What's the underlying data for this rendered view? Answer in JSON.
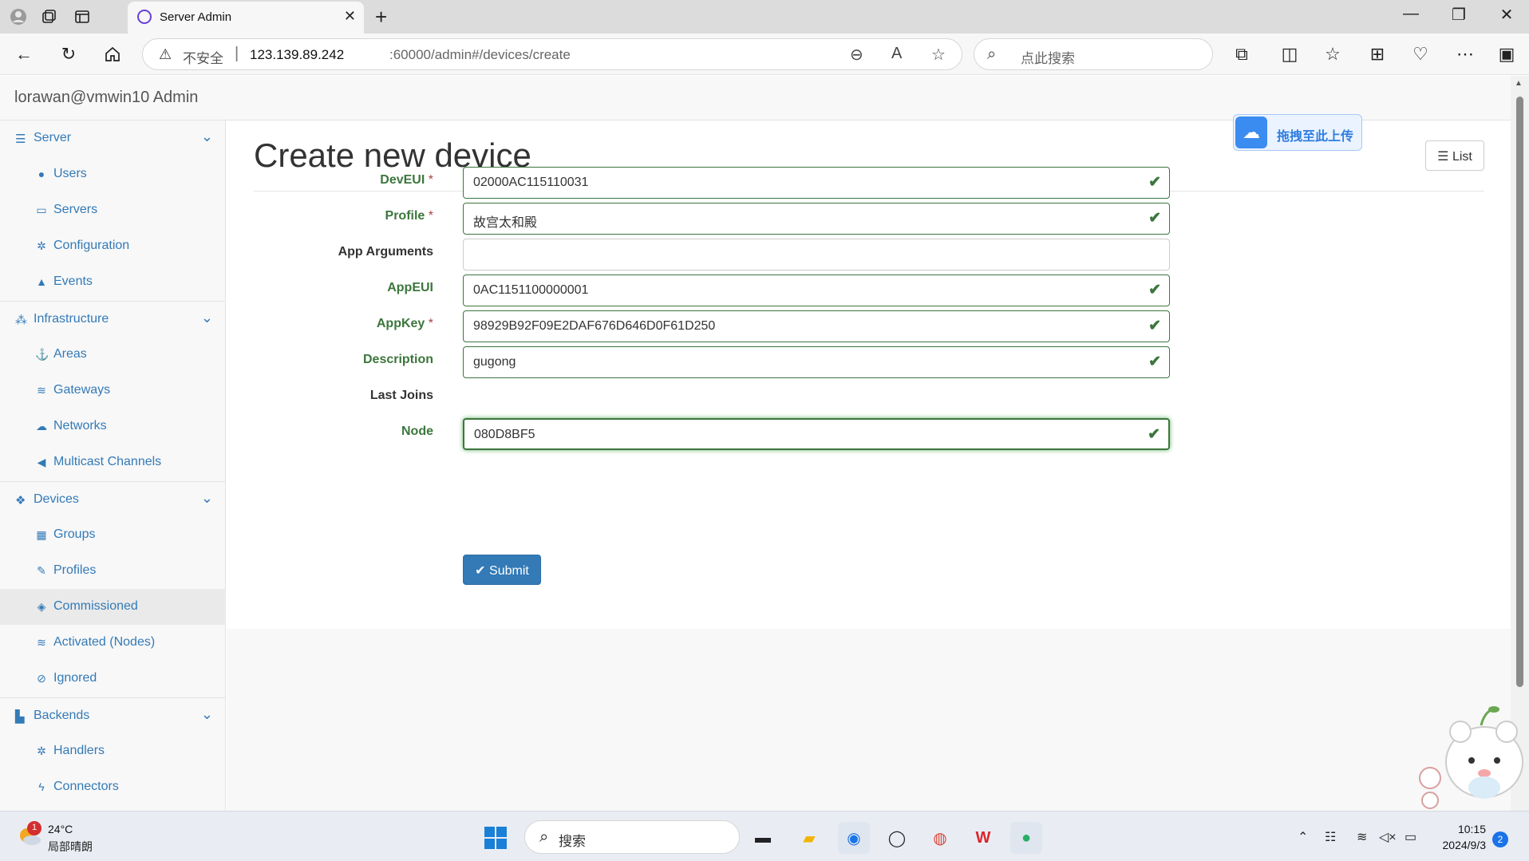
{
  "browser": {
    "tab_title": "Server Admin",
    "url_warning": "不安全",
    "url_host": "123.139.89.242",
    "url_path": ":60000/admin#/devices/create",
    "search_placeholder": "点此搜索"
  },
  "app": {
    "brand": "lorawan@vmwin10 Admin",
    "page_title": "Create new device",
    "list_button": "List",
    "upload_widget": "拖拽至此上传"
  },
  "sidebar": {
    "groups": [
      {
        "label": "Server",
        "icon": "server-icon",
        "items": [
          {
            "label": "Users",
            "icon": "user-icon"
          },
          {
            "label": "Servers",
            "icon": "desktop-icon"
          },
          {
            "label": "Configuration",
            "icon": "gear-icon"
          },
          {
            "label": "Events",
            "icon": "warning-icon"
          }
        ]
      },
      {
        "label": "Infrastructure",
        "icon": "sitemap-icon",
        "items": [
          {
            "label": "Areas",
            "icon": "anchor-icon"
          },
          {
            "label": "Gateways",
            "icon": "wifi-icon"
          },
          {
            "label": "Networks",
            "icon": "cloud-icon"
          },
          {
            "label": "Multicast Channels",
            "icon": "bullhorn-icon"
          }
        ]
      },
      {
        "label": "Devices",
        "icon": "cubes-icon",
        "items": [
          {
            "label": "Groups",
            "icon": "grid-icon"
          },
          {
            "label": "Profiles",
            "icon": "edit-icon"
          },
          {
            "label": "Commissioned",
            "icon": "cube-icon"
          },
          {
            "label": "Activated (Nodes)",
            "icon": "rss-icon"
          },
          {
            "label": "Ignored",
            "icon": "ban-icon"
          }
        ]
      },
      {
        "label": "Backends",
        "icon": "chart-icon",
        "items": [
          {
            "label": "Handlers",
            "icon": "cogs-icon"
          },
          {
            "label": "Connectors",
            "icon": "bolt-icon"
          }
        ]
      }
    ]
  },
  "form": {
    "fields": [
      {
        "label": "DevEUI",
        "required": "*",
        "value": "02000AC115110031"
      },
      {
        "label": "Profile",
        "required": "*",
        "value": "故宫太和殿"
      },
      {
        "label": "App Arguments",
        "required": "",
        "value": ""
      },
      {
        "label": "AppEUI",
        "required": "",
        "value": "0AC1151100000001"
      },
      {
        "label": "AppKey",
        "required": "*",
        "value": "98929B92F09E2DAF676D646D0F61D250"
      },
      {
        "label": "Description",
        "required": "",
        "value": "gugong"
      },
      {
        "label": "Last Joins",
        "required": "",
        "value": ""
      },
      {
        "label": "Node",
        "required": "",
        "value": "080D8BF5"
      }
    ],
    "submit": "Submit"
  },
  "taskbar": {
    "weather_temp": "24°C",
    "weather_desc": "局部晴朗",
    "weather_badge": "1",
    "search_label": "搜索",
    "time": "10:15",
    "date": "2024/9/3",
    "notifications": "2"
  },
  "colors": {
    "link": "#337ab7",
    "success": "#3c763d",
    "primary": "#337ab7"
  }
}
